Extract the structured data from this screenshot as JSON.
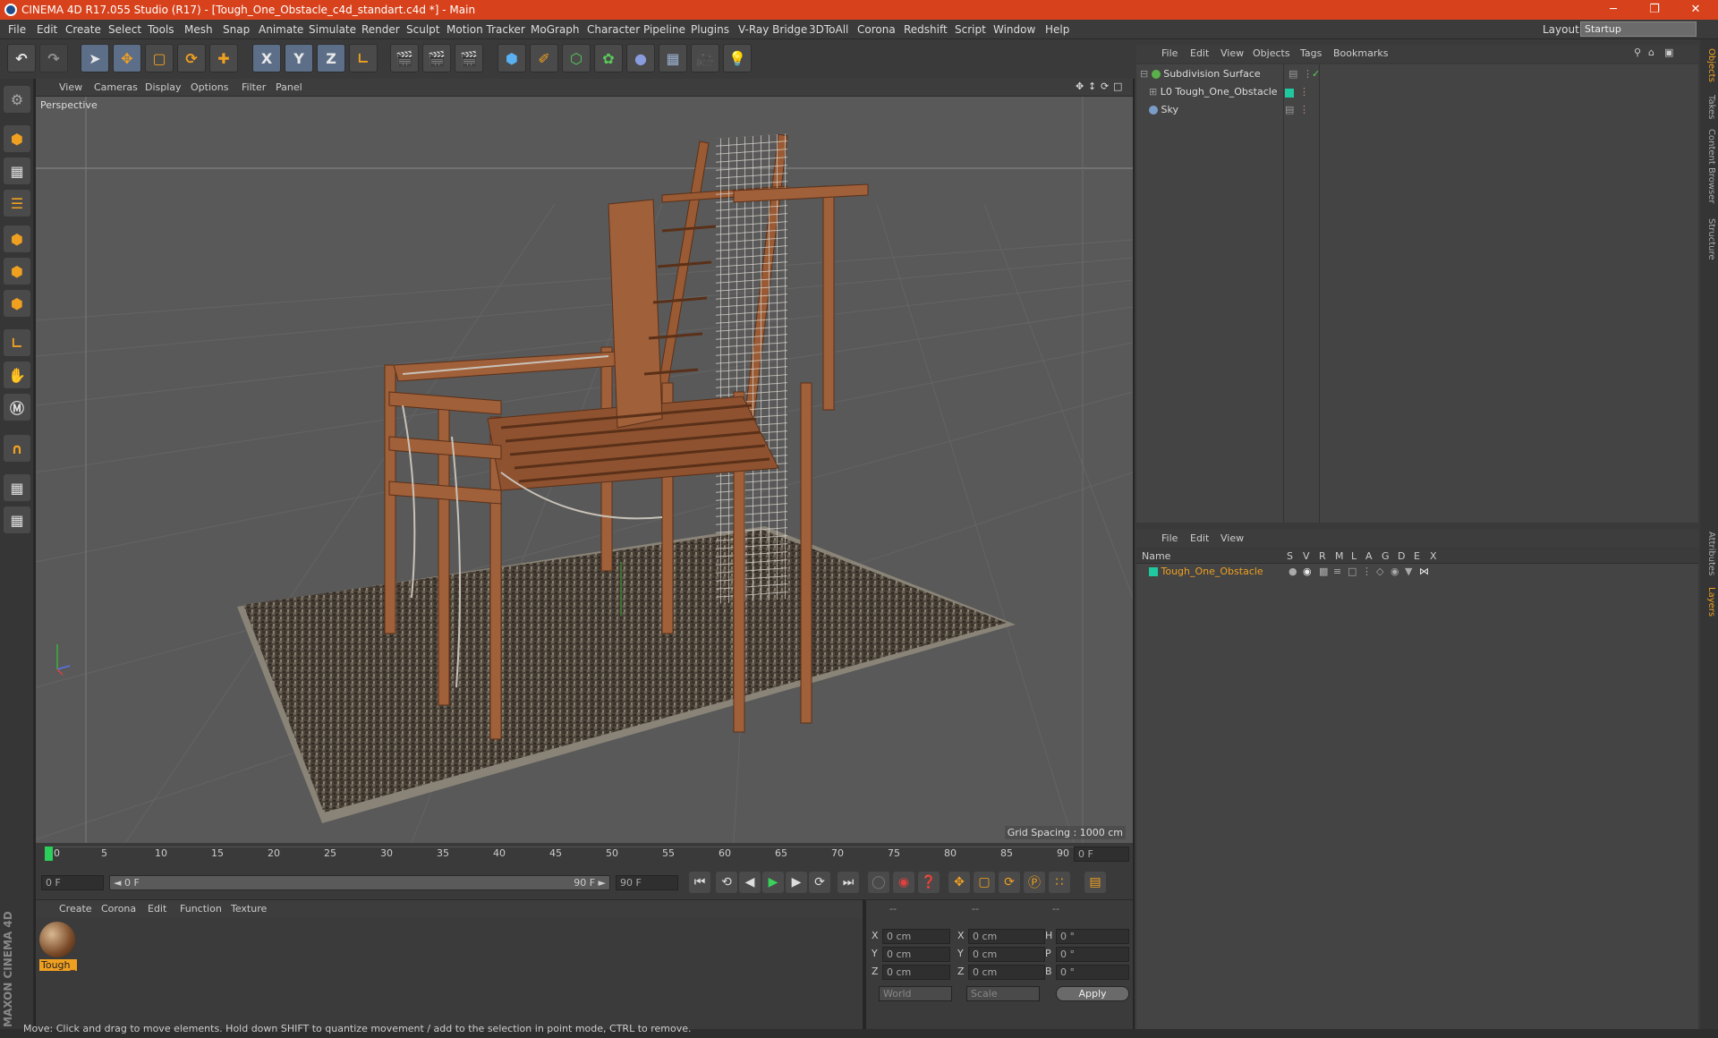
{
  "window": {
    "title": "CINEMA 4D R17.055 Studio (R17) - [Tough_One_Obstacle_c4d_standart.c4d *] - Main",
    "minimize": "─",
    "restore": "❐",
    "close": "✕"
  },
  "menu": {
    "items": [
      "File",
      "Edit",
      "Create",
      "Select",
      "Tools",
      "Mesh",
      "Snap",
      "Animate",
      "Simulate",
      "Render",
      "Sculpt",
      "Motion Tracker",
      "MoGraph",
      "Character",
      "Pipeline",
      "Plugins",
      "V-Ray Bridge",
      "3DToAll",
      "Corona",
      "Redshift",
      "Script",
      "Window",
      "Help"
    ],
    "layout_label": "Layout:",
    "layout_value": "Startup"
  },
  "toolbar": {
    "axis_x": "X",
    "axis_y": "Y",
    "axis_z": "Z"
  },
  "viewport": {
    "menu": [
      "View",
      "Cameras",
      "Display",
      "Options",
      "Filter",
      "Panel"
    ],
    "camera_label": "Perspective",
    "grid_spacing": "Grid Spacing : 1000 cm"
  },
  "timeline": {
    "ticks": [
      "0",
      "5",
      "10",
      "15",
      "20",
      "25",
      "30",
      "35",
      "40",
      "45",
      "50",
      "55",
      "60",
      "65",
      "70",
      "75",
      "80",
      "85",
      "90"
    ],
    "current_frame": "0 F",
    "start_field": "0 F",
    "range_start": "◄ 0 F",
    "range_end": "90 F ►",
    "end_field": "90 F"
  },
  "materials": {
    "menu": [
      "Create",
      "Corona",
      "Edit",
      "Function",
      "Texture"
    ],
    "items": [
      {
        "label": "Tough_"
      }
    ]
  },
  "coords": {
    "header": [
      "--",
      "--",
      "--"
    ],
    "rows": [
      {
        "a": "X",
        "av": "0 cm",
        "b": "X",
        "bv": "0 cm",
        "c": "H",
        "cv": "0 °"
      },
      {
        "a": "Y",
        "av": "0 cm",
        "b": "Y",
        "bv": "0 cm",
        "c": "P",
        "cv": "0 °"
      },
      {
        "a": "Z",
        "av": "0 cm",
        "b": "Z",
        "bv": "0 cm",
        "c": "B",
        "cv": "0 °"
      }
    ],
    "mode1": "World",
    "mode2": "Scale",
    "apply": "Apply"
  },
  "objects": {
    "menu": [
      "File",
      "Edit",
      "View",
      "Objects",
      "Tags",
      "Bookmarks"
    ],
    "items": [
      {
        "name": "Subdivision Surface",
        "color": "#5ab04a"
      },
      {
        "name": "Tough_One_Obstacle",
        "color": "#20c8a0"
      },
      {
        "name": "Sky",
        "color": "#7a9cc8"
      }
    ]
  },
  "layers": {
    "menu": [
      "File",
      "Edit",
      "View"
    ],
    "columns": [
      "Name",
      "S",
      "V",
      "R",
      "M",
      "L",
      "A",
      "G",
      "D",
      "E",
      "X"
    ],
    "items": [
      {
        "name": "Tough_One_Obstacle",
        "color": "#20c8a0"
      }
    ]
  },
  "sidetabs": [
    "Objects",
    "Takes",
    "Content Browser",
    "Structure",
    "Attributes",
    "Layers"
  ],
  "brand": "MAXON CINEMA 4D",
  "status": "Move: Click and drag to move elements. Hold down SHIFT to quantize movement / add to the selection in point mode, CTRL to remove."
}
